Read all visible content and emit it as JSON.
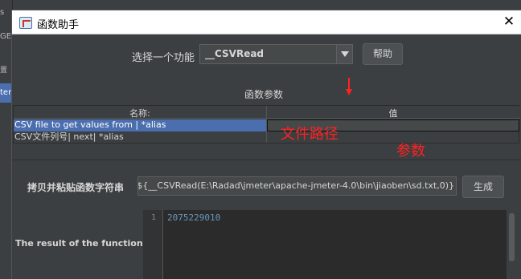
{
  "background_app": {
    "fragments": [
      "s",
      "GE",
      "置",
      "ter"
    ]
  },
  "dialog": {
    "title": "函数助手",
    "close_glyph": "✕"
  },
  "function_selector": {
    "label": "选择一个功能",
    "selected": "__CSVRead",
    "help_button": "帮助"
  },
  "params": {
    "section_title": "函数参数",
    "columns": [
      "名称:",
      "值"
    ],
    "rows": [
      {
        "name": "CSV file to get values from | *alias",
        "value": ""
      },
      {
        "name": "CSV文件列号| next| *alias",
        "value": ""
      }
    ]
  },
  "annotations": {
    "file_path": "文件路径",
    "param": "参数",
    "color": "#ff2222"
  },
  "function_string": {
    "label": "拷贝并粘贴函数字符串",
    "value": "${__CSVRead(E:\\Radad\\jmeter\\apache-jmeter-4.0\\bin\\jiaoben\\sd.txt,0)}",
    "generate_button": "生成"
  },
  "result": {
    "label": "The result of the function is",
    "line_number": "1",
    "text": "2075229010"
  }
}
